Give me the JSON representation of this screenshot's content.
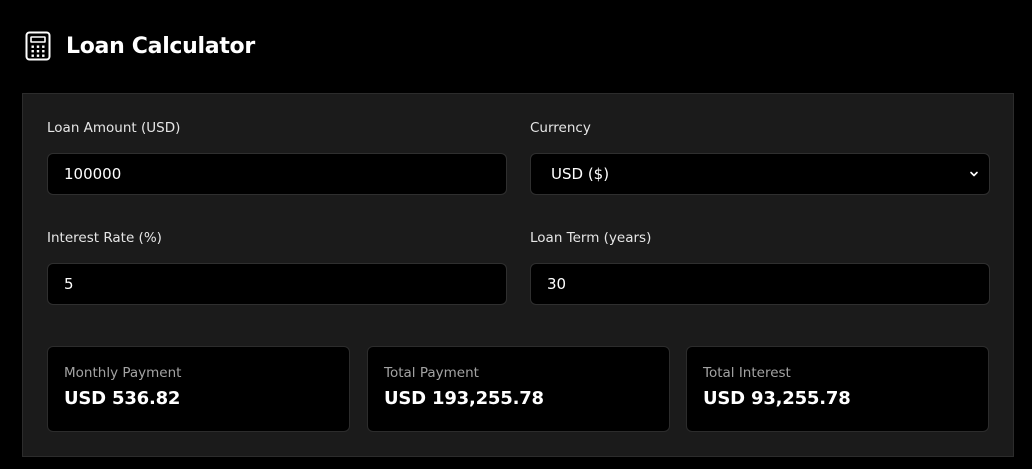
{
  "app": {
    "title": "Loan Calculator",
    "icon": "calculator-icon"
  },
  "form": {
    "loan_amount": {
      "label": "Loan Amount (USD)",
      "value": "100000"
    },
    "currency": {
      "label": "Currency",
      "value": "USD ($)"
    },
    "interest_rate": {
      "label": "Interest Rate (%)",
      "value": "5"
    },
    "loan_term": {
      "label": "Loan Term (years)",
      "value": "30"
    }
  },
  "results": {
    "monthly_payment": {
      "label": "Monthly Payment",
      "value": "USD 536.82"
    },
    "total_payment": {
      "label": "Total Payment",
      "value": "USD 193,255.78"
    },
    "total_interest": {
      "label": "Total Interest",
      "value": "USD 93,255.78"
    }
  },
  "colors": {
    "background": "#000000",
    "panel": "#1b1b1b",
    "text": "#ffffff",
    "muted_text": "#a3a3a3"
  }
}
